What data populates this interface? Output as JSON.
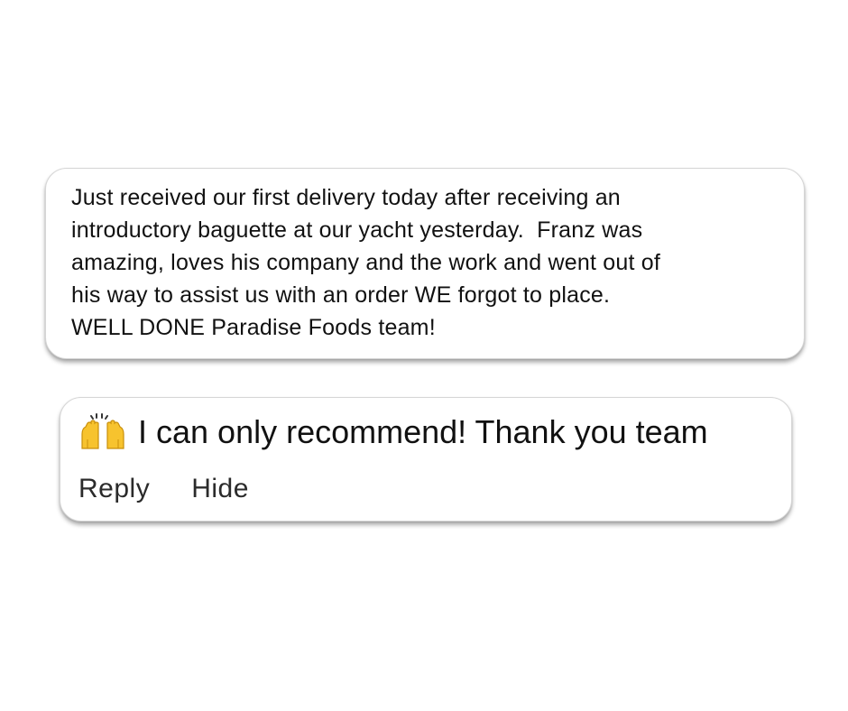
{
  "review": {
    "text": "Just received our first delivery today after receiving an\nintroductory baguette at our yacht yesterday.  Franz was\namazing, loves his company and the work and went out of\nhis way to assist us with an order WE forgot to place.\nWELL DONE Paradise Foods team!"
  },
  "reply": {
    "emoji": "raising-hands-icon",
    "text": "I can only recommend! Thank you team",
    "actions": {
      "reply_label": "Reply",
      "hide_label": "Hide"
    }
  },
  "colors": {
    "background": "#ffffff",
    "card_border": "#d6d6d6",
    "text": "#111111",
    "emoji_fill": "#f7c32e"
  }
}
